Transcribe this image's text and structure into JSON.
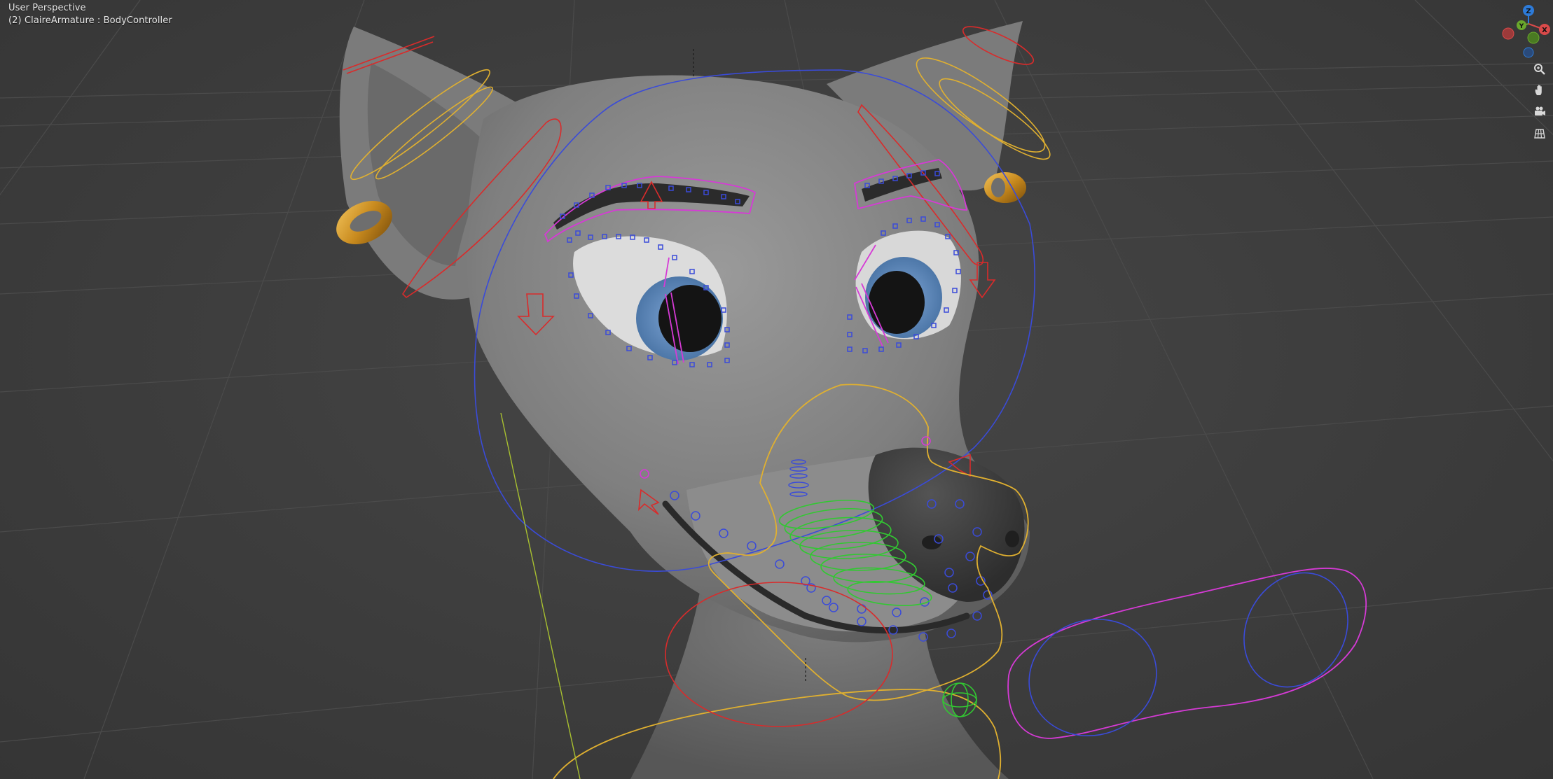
{
  "viewport": {
    "view_name": "User Perspective",
    "active_object": "(2) ClaireArmature : BodyController"
  },
  "gizmo": {
    "axes": [
      {
        "label": "Z",
        "color": "#2d7bd9"
      },
      {
        "label": "Y",
        "color": "#6aa82c"
      },
      {
        "label": "X",
        "color": "#d94a4a"
      }
    ]
  },
  "nav_tools": [
    {
      "name": "zoom-icon"
    },
    {
      "name": "hand-pan-icon"
    },
    {
      "name": "camera-icon"
    },
    {
      "name": "orthographic-grid-icon"
    }
  ],
  "colors": {
    "background": "#3d3d3d",
    "grid_line": "#4a4a4a",
    "mesh": "#8a8a8a",
    "bone_yellow": "#e0b030",
    "bone_red": "#d92b2b",
    "bone_magenta": "#d63ad6",
    "bone_blue": "#3a4bd9",
    "bone_green": "#32c832",
    "earring_gold": "#c88a1e"
  }
}
